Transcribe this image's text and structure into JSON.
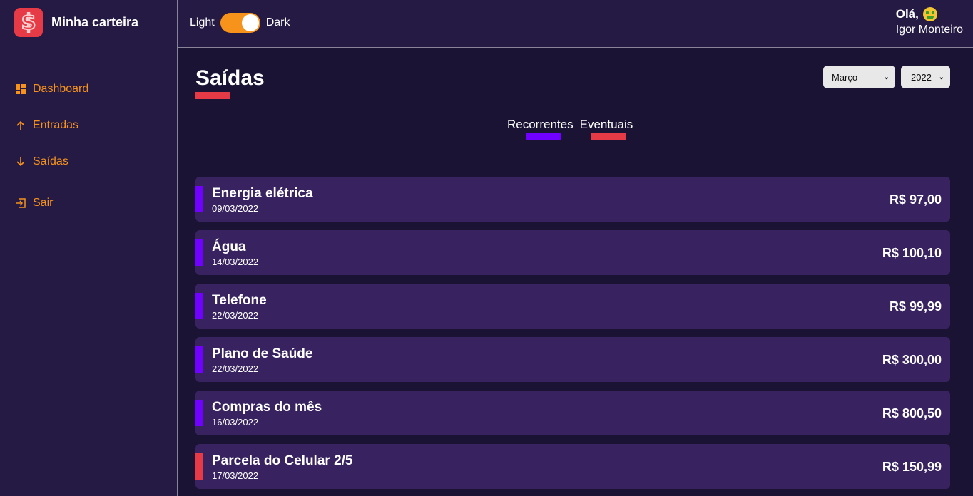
{
  "brand": {
    "name": "Minha carteira",
    "logo_symbol": "$",
    "logo_color": "#e63a46"
  },
  "sidebar": {
    "items": [
      {
        "label": "Dashboard",
        "icon": "dashboard-icon"
      },
      {
        "label": "Entradas",
        "icon": "arrow-up-icon"
      },
      {
        "label": "Saídas",
        "icon": "arrow-down-icon"
      },
      {
        "label": "Sair",
        "icon": "logout-icon"
      }
    ],
    "accent": "#f7931b"
  },
  "header": {
    "theme": {
      "light_label": "Light",
      "dark_label": "Dark"
    },
    "greeting": "Olá,",
    "greeting_icon": "money-mouth-face-icon",
    "user_name": "Igor Monteiro"
  },
  "main": {
    "title": "Saídas",
    "filters": {
      "month": "Março",
      "year": "2022"
    },
    "tabs": [
      {
        "label": "Recorrentes",
        "color": "#7000ff"
      },
      {
        "label": "Eventuais",
        "color": "#e63a46"
      }
    ],
    "items": [
      {
        "title": "Energia elétrica",
        "date": "09/03/2022",
        "amount": "R$ 97,00",
        "color": "#7000ff"
      },
      {
        "title": "Água",
        "date": "14/03/2022",
        "amount": "R$ 100,10",
        "color": "#7000ff"
      },
      {
        "title": "Telefone",
        "date": "22/03/2022",
        "amount": "R$ 99,99",
        "color": "#7000ff"
      },
      {
        "title": "Plano de Saúde",
        "date": "22/03/2022",
        "amount": "R$ 300,00",
        "color": "#7000ff"
      },
      {
        "title": "Compras do mês",
        "date": "16/03/2022",
        "amount": "R$ 800,50",
        "color": "#7000ff"
      },
      {
        "title": "Parcela do Celular 2/5",
        "date": "17/03/2022",
        "amount": "R$ 150,99",
        "color": "#e63a46"
      }
    ]
  }
}
